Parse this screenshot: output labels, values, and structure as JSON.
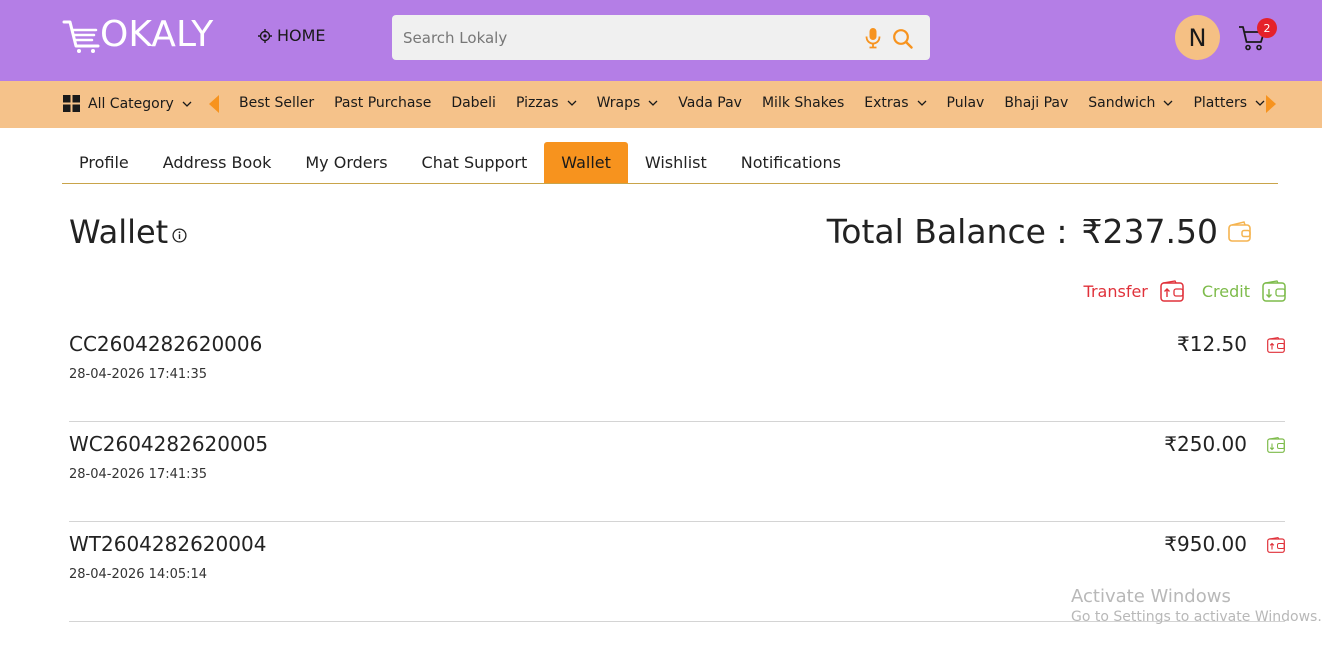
{
  "header": {
    "logo_text": "OKALY",
    "home_label": "HOME",
    "search_placeholder": "Search Lokaly",
    "avatar_initial": "N",
    "cart_count": "2"
  },
  "categories": {
    "all_label": "All Category",
    "items": [
      {
        "label": "Best Seller",
        "dropdown": false
      },
      {
        "label": "Past Purchase",
        "dropdown": false
      },
      {
        "label": "Dabeli",
        "dropdown": false
      },
      {
        "label": "Pizzas",
        "dropdown": true
      },
      {
        "label": "Wraps",
        "dropdown": true
      },
      {
        "label": "Vada Pav",
        "dropdown": false
      },
      {
        "label": "Milk Shakes",
        "dropdown": false
      },
      {
        "label": "Extras",
        "dropdown": true
      },
      {
        "label": "Pulav",
        "dropdown": false
      },
      {
        "label": "Bhaji Pav",
        "dropdown": false
      },
      {
        "label": "Sandwich",
        "dropdown": true
      },
      {
        "label": "Platters",
        "dropdown": true
      }
    ]
  },
  "tabs": [
    {
      "label": "Profile",
      "active": false
    },
    {
      "label": "Address Book",
      "active": false
    },
    {
      "label": "My Orders",
      "active": false
    },
    {
      "label": "Chat Support",
      "active": false
    },
    {
      "label": "Wallet",
      "active": true
    },
    {
      "label": "Wishlist",
      "active": false
    },
    {
      "label": "Notifications",
      "active": false
    }
  ],
  "wallet": {
    "title": "Wallet",
    "total_label": "Total Balance :",
    "total_value": "₹237.50",
    "transfer_label": "Transfer",
    "credit_label": "Credit"
  },
  "transactions": [
    {
      "id": "CC2604282620006",
      "date": "28-04-2026 17:41:35",
      "amount": "₹12.50",
      "type": "transfer"
    },
    {
      "id": "WC2604282620005",
      "date": "28-04-2026 17:41:35",
      "amount": "₹250.00",
      "type": "credit"
    },
    {
      "id": "WT2604282620004",
      "date": "28-04-2026 14:05:14",
      "amount": "₹950.00",
      "type": "transfer"
    }
  ],
  "watermark": {
    "line1": "Activate Windows",
    "line2": "Go to Settings to activate Windows."
  },
  "colors": {
    "header_bg": "#b47ee6",
    "category_bg": "#f5c28a",
    "active_tab": "#f7931e",
    "transfer": "#e0313a",
    "credit": "#7dbb4a"
  }
}
